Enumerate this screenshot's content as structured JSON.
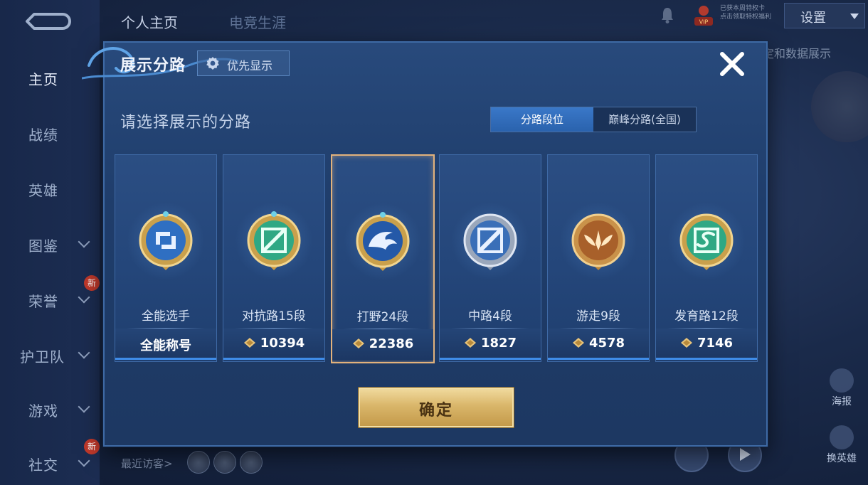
{
  "sidebar": {
    "items": [
      {
        "label": "主页"
      },
      {
        "label": "战绩"
      },
      {
        "label": "英雄"
      },
      {
        "label": "图鉴"
      },
      {
        "label": "荣誉",
        "badge": "新"
      },
      {
        "label": "护卫队"
      },
      {
        "label": "游戏"
      },
      {
        "label": "社交",
        "badge": "新"
      }
    ]
  },
  "topbar": {
    "tabs": [
      "个人主页",
      "电竞生涯"
    ],
    "vip_text": "VIP",
    "vip_lines": [
      "已获本周特权卡",
      "点击领取特权福利"
    ],
    "settings_label": "设置",
    "bg_text": "定和数据展示"
  },
  "right_buttons": [
    {
      "label": "海报"
    },
    {
      "label": "换英雄"
    }
  ],
  "visitors": {
    "label": "最近访客>"
  },
  "modal": {
    "title": "展示分路",
    "priority_label": "优先显示",
    "subtitle": "请选择展示的分路",
    "tabs": [
      {
        "label": "分路段位",
        "active": true
      },
      {
        "label": "巅峰分路(全国)",
        "active": false
      }
    ],
    "cards": [
      {
        "name": "全能选手",
        "value": "全能称号",
        "icon": "all-round-icon",
        "selected": false
      },
      {
        "name": "对抗路15段",
        "value": "10394",
        "icon": "clash-lane-icon",
        "selected": false
      },
      {
        "name": "打野24段",
        "value": "22386",
        "icon": "jungle-icon",
        "selected": true
      },
      {
        "name": "中路4段",
        "value": "1827",
        "icon": "mid-lane-icon",
        "selected": false
      },
      {
        "name": "游走9段",
        "value": "4578",
        "icon": "roam-icon",
        "selected": false
      },
      {
        "name": "发育路12段",
        "value": "7146",
        "icon": "farm-lane-icon",
        "selected": false
      }
    ],
    "confirm_label": "确定"
  },
  "colors": {
    "accent_blue": "#2a62ad",
    "gold": "#d9b66a",
    "selected_border": "#e2b27c"
  }
}
